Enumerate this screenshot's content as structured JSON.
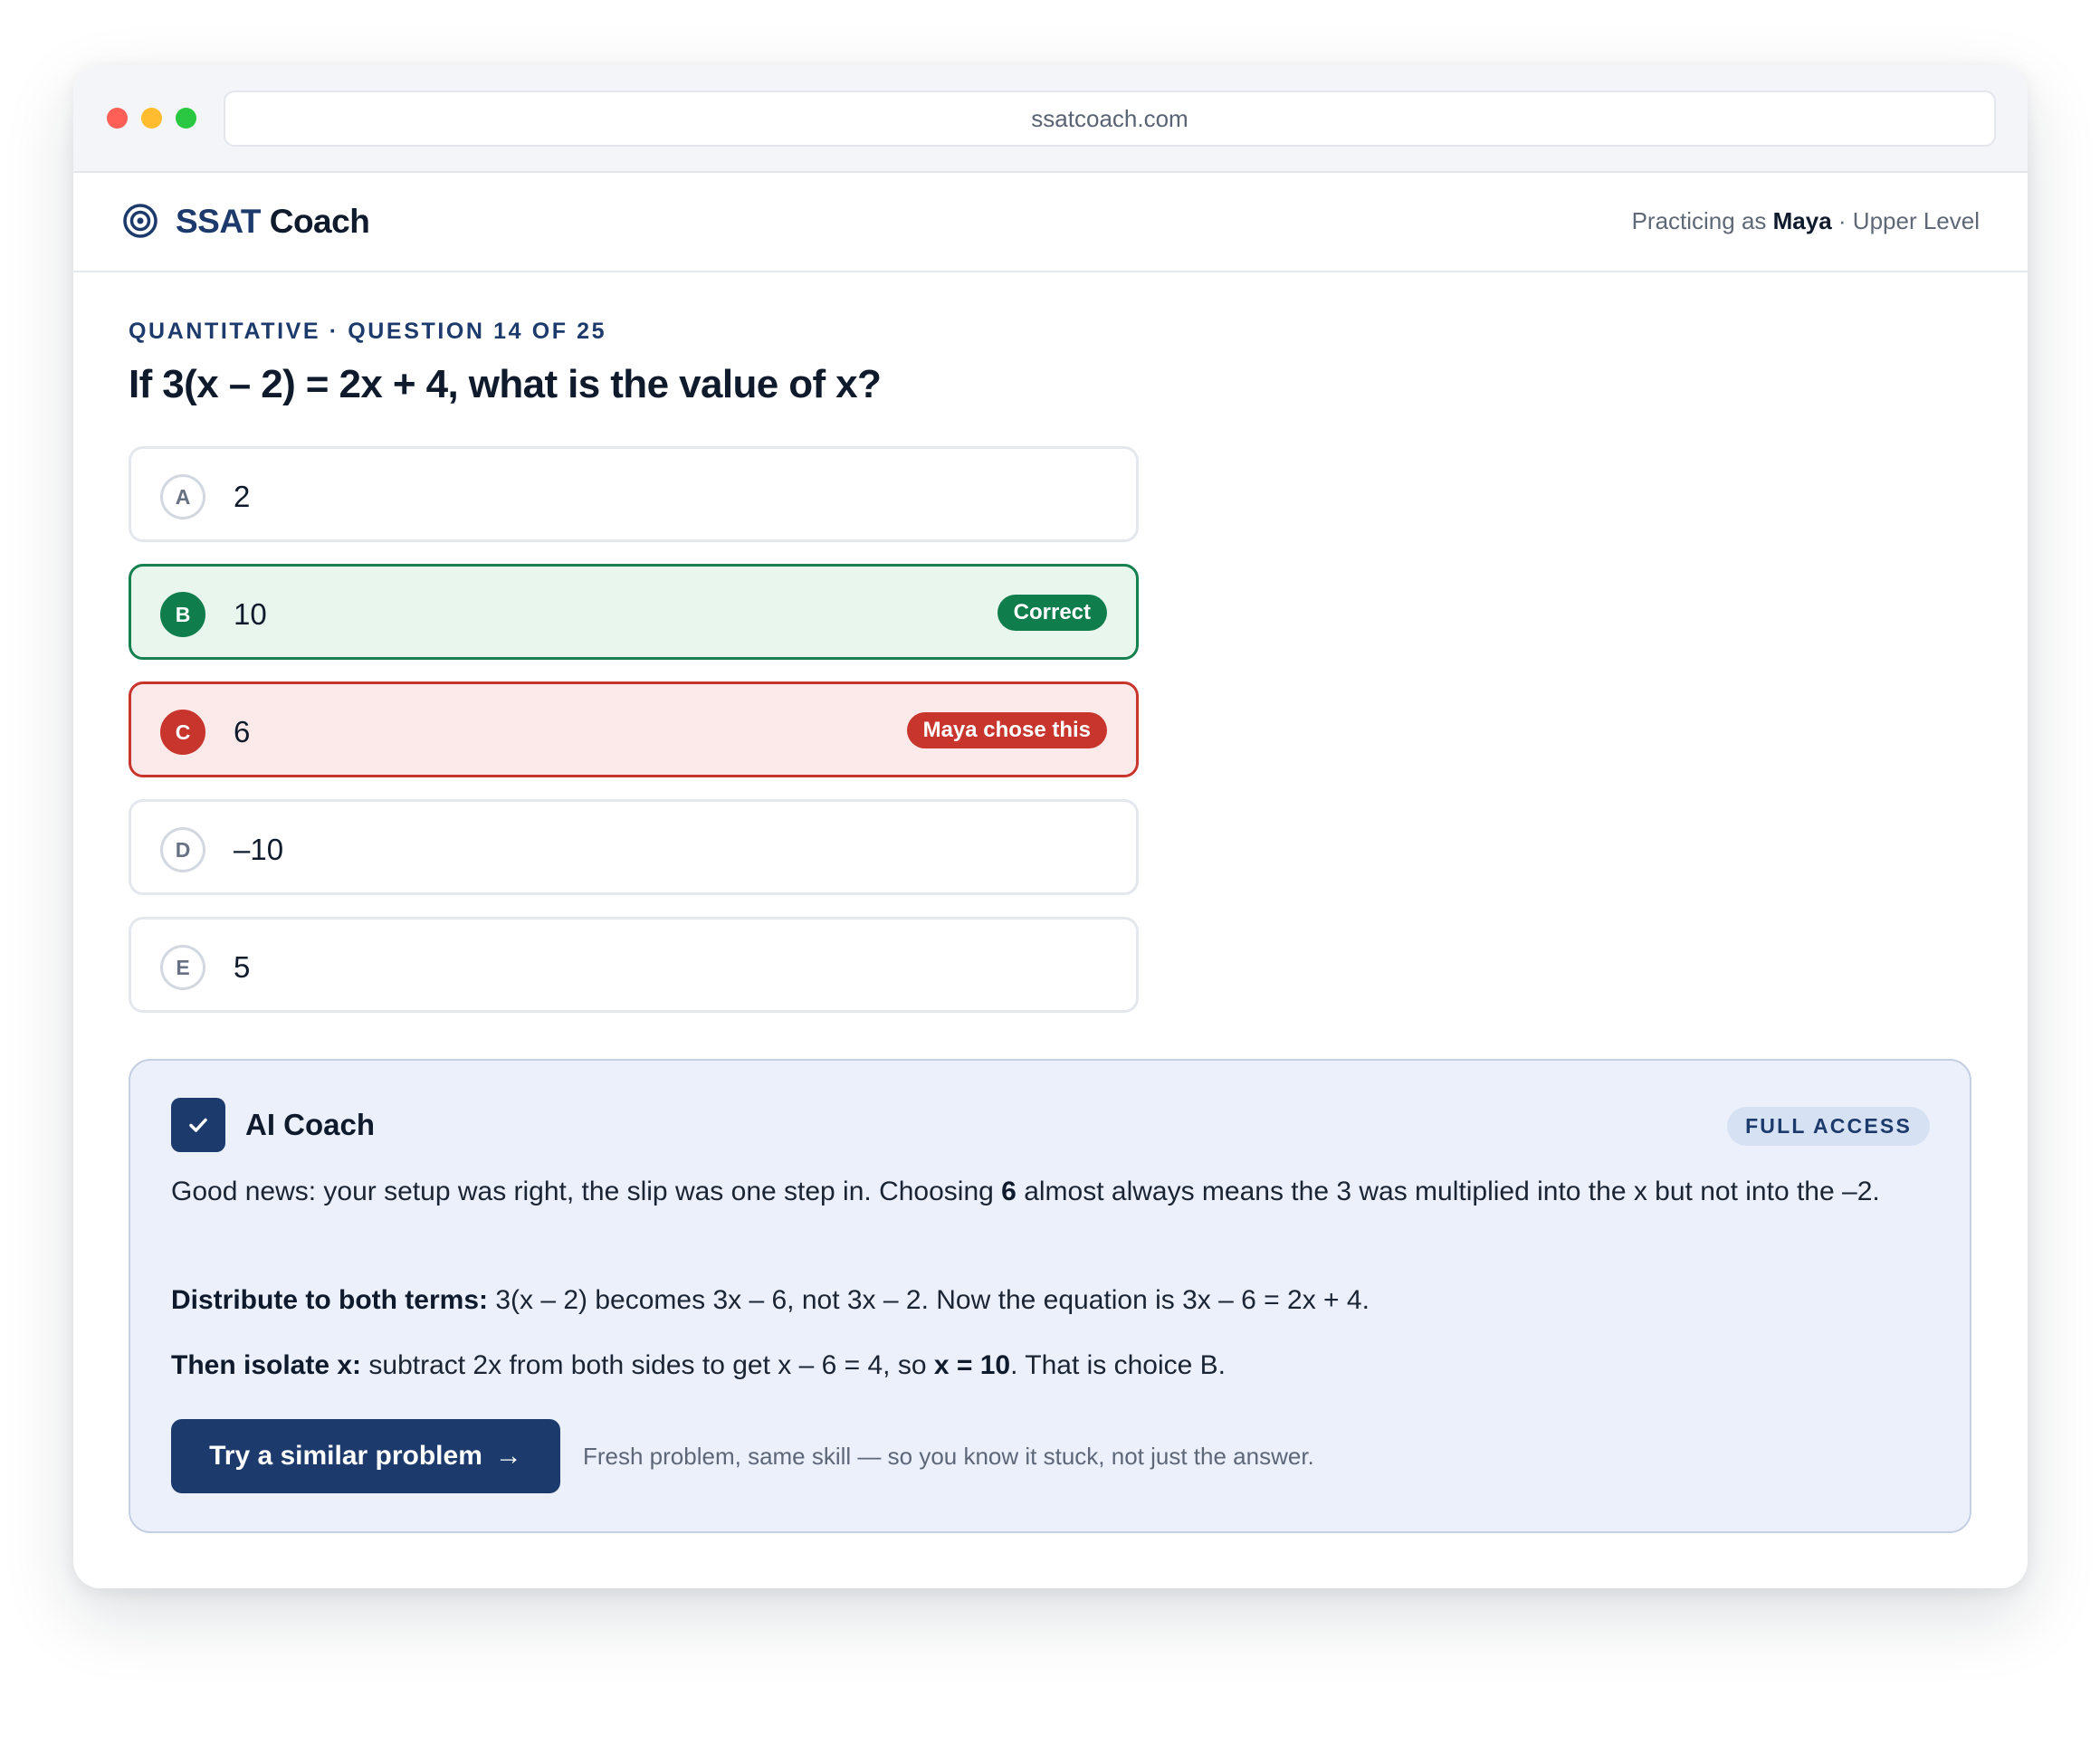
{
  "browser": {
    "url": "ssatcoach.com"
  },
  "header": {
    "brand_strong": "SSAT",
    "brand_rest": " Coach",
    "user_prefix": "Practicing as ",
    "user_name": "Maya",
    "user_suffix": " · Upper Level"
  },
  "question": {
    "eyebrow": "QUANTITATIVE · QUESTION 14 OF 25",
    "prompt": "If 3(x – 2) = 2x + 4, what is the value of x?",
    "choices": [
      {
        "letter": "A",
        "text": "2"
      },
      {
        "letter": "B",
        "text": "10",
        "badge": "Correct",
        "state": "correct"
      },
      {
        "letter": "C",
        "text": "6",
        "badge": "Maya chose this",
        "state": "selected-wrong"
      },
      {
        "letter": "D",
        "text": "–10"
      },
      {
        "letter": "E",
        "text": "5"
      }
    ]
  },
  "coach": {
    "title": "AI Coach",
    "access_badge": "FULL ACCESS",
    "p1_a": "Good news: your setup was right, the slip was one step in. Choosing ",
    "p1_b": "6",
    "p1_c": " almost always means the 3 was multiplied into the x but not into the –2.",
    "p2_a": "Distribute to both terms:",
    "p2_b": " 3(x – 2) becomes 3x – 6, not 3x – 2. Now the equation is 3x – 6 = 2x + 4.",
    "p3_a": "Then isolate x:",
    "p3_b": " subtract 2x from both sides to get x – 6 = 4, so ",
    "p3_c": "x = 10",
    "p3_d": ". That is choice B.",
    "cta_label": "Try a similar problem",
    "cta_arrow": "→",
    "cta_note": "Fresh problem, same skill — so you know it stuck, not just the answer."
  },
  "colors": {
    "brand_navy": "#1c3a6b",
    "correct_green": "#0f7d4c",
    "wrong_red": "#c8352d",
    "coach_bg": "#ebf0fb"
  }
}
